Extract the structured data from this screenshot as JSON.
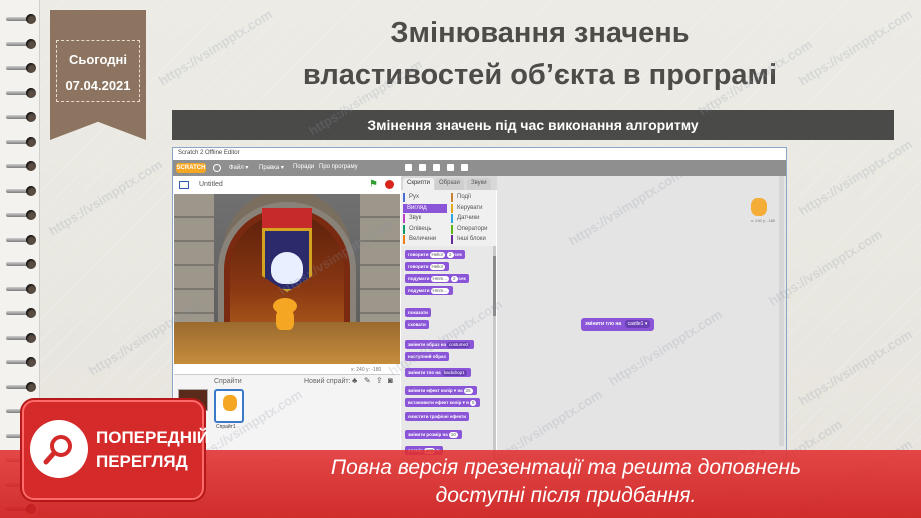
{
  "date": {
    "label": "Сьогодні",
    "value": "07.04.2021"
  },
  "title": {
    "line1": "Змінювання  значень",
    "line2": "властивостей об’єкта в програмі"
  },
  "subtitle": "Змінення значень під час виконання алгоритму",
  "scratch": {
    "window_title": "Scratch 2 Offline Editor",
    "logo": "SCRATCH",
    "menu": [
      "Файл ▾",
      "Правка ▾",
      "Поради",
      "Про програму"
    ],
    "project_name": "Untitled",
    "stage_coords": "x: 240  y: -180",
    "sprites_label": "Спрайти",
    "new_sprite_label": "Новий спрайт:",
    "sprite_name": "Спрайт1",
    "tabs": [
      "Скрипти",
      "Образи",
      "Звуки"
    ],
    "categories": [
      {
        "label": "Рух",
        "color": "#4a6cd4"
      },
      {
        "label": "Події",
        "color": "#c88330"
      },
      {
        "label": "Вигляд",
        "color": "#8a55d7"
      },
      {
        "label": "Керувати",
        "color": "#e1a91a"
      },
      {
        "label": "Звук",
        "color": "#bb42c3"
      },
      {
        "label": "Датчики",
        "color": "#2ca5e2"
      },
      {
        "label": "Олівець",
        "color": "#0e9a6c"
      },
      {
        "label": "Оператори",
        "color": "#5cb712"
      },
      {
        "label": "Величини",
        "color": "#ee7d16"
      },
      {
        "label": "Інші блоки",
        "color": "#632d99"
      }
    ],
    "blocks": [
      {
        "text": "говорити",
        "slot": "Hello!",
        "tail": "2",
        "tail2": "сек"
      },
      {
        "text": "говорити",
        "slot": "Hello!"
      },
      {
        "text": "подумати",
        "slot": "Hmm...",
        "tail": "2",
        "tail2": "сек"
      },
      {
        "text": "подумати",
        "slot": "Hmm..."
      },
      {
        "text": "показати"
      },
      {
        "text": "сховати"
      },
      {
        "text": "змінити образ на",
        "dd": "costume2"
      },
      {
        "text": "наступний образ"
      },
      {
        "text": "змінити тло на",
        "dd": "backdrop1"
      },
      {
        "text": "змінити ефект колір ▾ на",
        "slot": "25"
      },
      {
        "text": "встановити ефект колір ▾ в",
        "slot": "0"
      },
      {
        "text": "очистити графічні ефекти"
      },
      {
        "text": "змінити розмір на",
        "slot": "10"
      },
      {
        "text": "розмір",
        "slot": "100",
        "tail2": "%"
      }
    ],
    "script_block": {
      "text": "змінити тло на",
      "dd": "castle1 ▾"
    },
    "sprite_mini_xy": "x: 240 y: -180"
  },
  "watermark": "https://vsimpptx.com",
  "preview": {
    "badge_line1": "ПОПЕРЕДНІЙ",
    "badge_line2": "ПЕРЕГЛЯД",
    "message_line1": "Повна версія презентації та решта доповнень",
    "message_line2": "доступні після придбання."
  }
}
